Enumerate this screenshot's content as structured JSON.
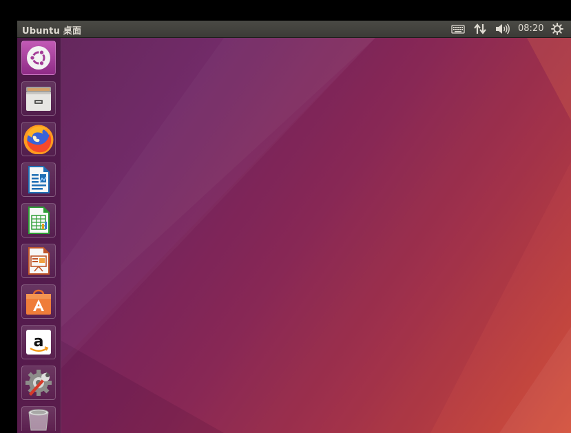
{
  "panel": {
    "title": "Ubuntu 桌面",
    "clock": "08:20",
    "indicators": [
      "keyboard-icon",
      "network-icon",
      "volume-icon",
      "power-icon"
    ]
  },
  "launcher": {
    "items": [
      {
        "name": "dash-home",
        "icon": "ubuntu-logo-icon"
      },
      {
        "name": "files",
        "icon": "file-cabinet-icon"
      },
      {
        "name": "firefox",
        "icon": "firefox-icon"
      },
      {
        "name": "libreoffice-writer",
        "icon": "writer-document-icon"
      },
      {
        "name": "libreoffice-calc",
        "icon": "calc-spreadsheet-icon"
      },
      {
        "name": "libreoffice-impress",
        "icon": "impress-presentation-icon"
      },
      {
        "name": "ubuntu-software",
        "icon": "software-bag-icon"
      },
      {
        "name": "amazon",
        "icon": "amazon-icon"
      },
      {
        "name": "system-settings",
        "icon": "settings-gear-wrench-icon"
      },
      {
        "name": "trash",
        "icon": "trash-icon"
      }
    ]
  },
  "colors": {
    "panel_bg": "#3c3b37",
    "panel_text": "#dfdbd2",
    "wallpaper_purple": "#6d2463",
    "wallpaper_orange": "#d3513a"
  }
}
